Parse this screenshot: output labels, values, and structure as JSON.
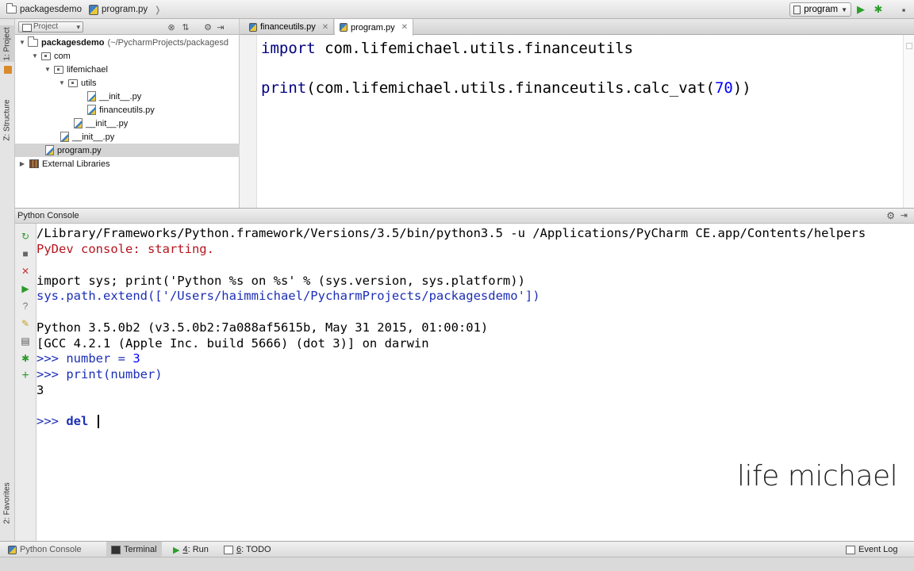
{
  "navbar": {
    "crumbs": [
      "packagesdemo",
      "program.py"
    ],
    "run_config": "program"
  },
  "left_strip": {
    "project_tab": "1: Project",
    "structure_tab": "Z: Structure",
    "favorites_tab": "2: Favorites"
  },
  "project_panel": {
    "view_selector": "Project",
    "tree": [
      {
        "label": "packagesdemo",
        "suffix": "(~/PycharmProjects/packagesd"
      },
      {
        "label": "com"
      },
      {
        "label": "lifemichael"
      },
      {
        "label": "utils"
      },
      {
        "label": "__init__.py"
      },
      {
        "label": "financeutils.py"
      },
      {
        "label": "__init__.py"
      },
      {
        "label": "__init__.py"
      },
      {
        "label": "program.py"
      },
      {
        "label": "External Libraries"
      }
    ]
  },
  "editor": {
    "tabs": [
      {
        "label": "financeutils.py"
      },
      {
        "label": "program.py"
      }
    ],
    "line1": {
      "kw": "import",
      "rest": " com.lifemichael.utils.financeutils"
    },
    "line2": {
      "kw": "print",
      "mid": "(com.lifemichael.utils.financeutils.calc_vat(",
      "num": "70",
      "end": "))"
    }
  },
  "console": {
    "title": "Python Console",
    "lines": {
      "cmd": "/Library/Frameworks/Python.framework/Versions/3.5/bin/python3.5 -u /Applications/PyCharm CE.app/Contents/helpers",
      "starting": "PyDev console: starting.",
      "import_sys": "import sys; print('Python %s on %s' % (sys.version, sys.platform))",
      "path_extend": "sys.path.extend(['/Users/haimmichael/PycharmProjects/packagesdemo'])",
      "version": "Python 3.5.0b2 (v3.5.0b2:7a088af5615b, May 31 2015, 01:00:01)",
      "gcc": "[GCC 4.2.1 (Apple Inc. build 5666) (dot 3)] on darwin",
      "in1_prompt": ">>> ",
      "in1_code": "number = ",
      "in1_num": "3",
      "in2_prompt": ">>> ",
      "in2_code": "print(number)",
      "out": "3",
      "in3_prompt": ">>> ",
      "in3_code": "del "
    }
  },
  "watermark": "life michael",
  "bottombar": {
    "python_console": "Python Console",
    "terminal": "Terminal",
    "run_num": "4",
    "run_label": ": Run",
    "todo_num": "6",
    "todo_label": ": TODO",
    "event_log": "Event Log"
  }
}
